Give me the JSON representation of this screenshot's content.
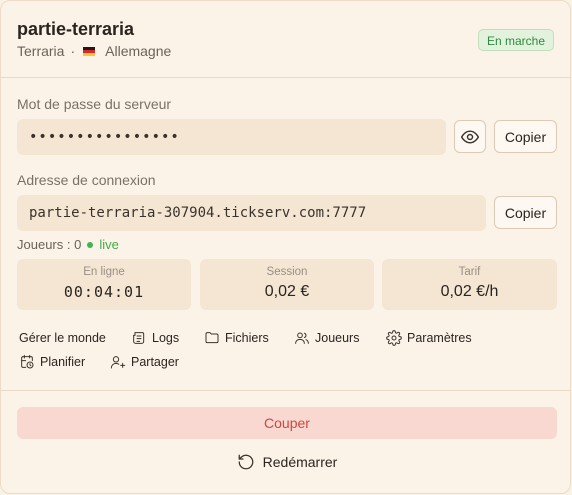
{
  "server": {
    "name": "partie-terraria",
    "game": "Terraria",
    "separator": "·",
    "country": "Allemagne",
    "status": "En marche"
  },
  "password": {
    "label": "Mot de passe du serveur",
    "masked_value": "••••••••••••••••",
    "copy_label": "Copier",
    "reveal_icon": "eye-icon"
  },
  "connection": {
    "label": "Adresse de connexion",
    "address": "partie-terraria-307904.tickserv.com:7777",
    "copy_label": "Copier"
  },
  "players": {
    "text": "Joueurs : 0",
    "live_label": "live"
  },
  "stats": [
    {
      "label": "En ligne",
      "value": "00:04:01"
    },
    {
      "label": "Session",
      "value": "0,02 €"
    },
    {
      "label": "Tarif",
      "value": "0,02 €/h"
    }
  ],
  "actions": {
    "manage_world": "Gérer le monde",
    "logs": "Logs",
    "files": "Fichiers",
    "players": "Joueurs",
    "settings": "Paramètres",
    "schedule": "Planifier",
    "share": "Partager"
  },
  "buttons": {
    "stop": "Couper",
    "restart": "Redémarrer"
  },
  "colors": {
    "background": "#fcf3e8",
    "accent_green": "#3fae4a",
    "danger": "#d2463a",
    "danger_bg": "#f9d8d2"
  }
}
